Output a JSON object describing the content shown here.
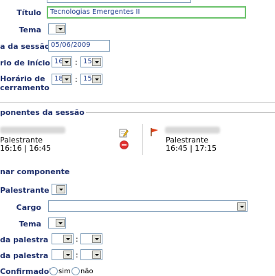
{
  "form": {
    "titulo": {
      "label": "Título",
      "value": "Tecnologias Emergentes II"
    },
    "tema": {
      "label": "Tema"
    },
    "data_sessao": {
      "label": "a da sessão",
      "value": "05/06/2009"
    },
    "horario_inicio": {
      "label": "rio de início",
      "hour": "16",
      "minute": "15",
      "sep": ":"
    },
    "horario_encerramento": {
      "label_line1": "Horário de",
      "label_line2": "cerramento",
      "hour": "18",
      "minute": "15",
      "sep": ":"
    }
  },
  "components_section": {
    "title": "ponentes da sessão",
    "items": [
      {
        "role": "Palestrante",
        "time": "16:16 | 16:45"
      },
      {
        "role": "Palestrante",
        "time": "16:45 | 17:15"
      }
    ]
  },
  "add_section": {
    "title": "nar componente",
    "palestrante": {
      "label": "Palestrante"
    },
    "cargo": {
      "label": "Cargo",
      "value": ""
    },
    "tema": {
      "label": "Tema"
    },
    "inicio": {
      "label": "da palestra",
      "sep": ":"
    },
    "fim": {
      "label": "da palestra",
      "sep": ":"
    },
    "confirmado": {
      "label": "Confirmado?",
      "opt_sim": "sim",
      "opt_nao": "não"
    }
  },
  "icons": [
    "edit-icon",
    "delete-icon",
    "flag-icon"
  ],
  "colors": {
    "label": "#1e2f6b",
    "input_border": "#7f9db9",
    "focus_border": "#6cc36c",
    "delete_red": "#e03030",
    "flag_red": "#e0401a"
  }
}
